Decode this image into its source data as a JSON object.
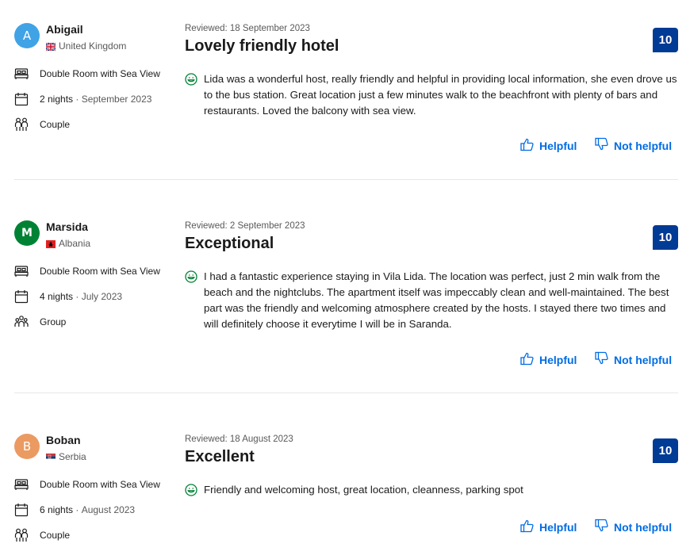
{
  "colors": {
    "accent": "#006ce4",
    "score_bg": "#003b95",
    "positive": "#008234"
  },
  "labels": {
    "helpful": "Helpful",
    "not_helpful": "Not helpful"
  },
  "icons": {
    "avatar": "avatar",
    "flag": "flag-icon",
    "room": "bed-icon",
    "stay": "calendar-icon",
    "traveler": "people-icon",
    "positive": "smiley-icon",
    "helpful": "thumbs-up-icon",
    "not_helpful": "thumbs-down-icon"
  },
  "reviews": [
    {
      "initial": "A",
      "avatar_color": "#40a3e6",
      "name": "Abigail",
      "country": "United Kingdom",
      "room": "Double Room with Sea View",
      "nights": "2 nights",
      "stay_date": "September 2023",
      "traveler": "Couple",
      "reviewed": "Reviewed: 18 September 2023",
      "title": "Lovely friendly hotel",
      "score": "10",
      "text": "Lida was a wonderful host, really friendly and helpful in providing local information, she even drove us to the bus station. Great location just a few minutes walk to the beachfront with plenty of bars and restaurants. Loved the balcony with sea view."
    },
    {
      "initial": "M",
      "avatar_color": "#008234",
      "name": "Marsida",
      "country": "Albania",
      "room": "Double Room with Sea View",
      "nights": "4 nights",
      "stay_date": "July 2023",
      "traveler": "Group",
      "reviewed": "Reviewed: 2 September 2023",
      "title": "Exceptional",
      "score": "10",
      "text": "I had a fantastic experience staying in Vila Lida. The location was perfect, just 2 min walk from the beach and the nightclubs. The apartment itself was impeccably clean and well-maintained. The best part was the friendly and welcoming atmosphere created by the hosts. I stayed there two times and will definitely choose it everytime I will be in Saranda."
    },
    {
      "initial": "B",
      "avatar_color": "#eb9a62",
      "name": "Boban",
      "country": "Serbia",
      "room": "Double Room with Sea View",
      "nights": "6 nights",
      "stay_date": "August 2023",
      "traveler": "Couple",
      "reviewed": "Reviewed: 18 August 2023",
      "title": "Excellent",
      "score": "10",
      "text": "Friendly and welcoming host, great location, cleanness, parking spot"
    }
  ]
}
